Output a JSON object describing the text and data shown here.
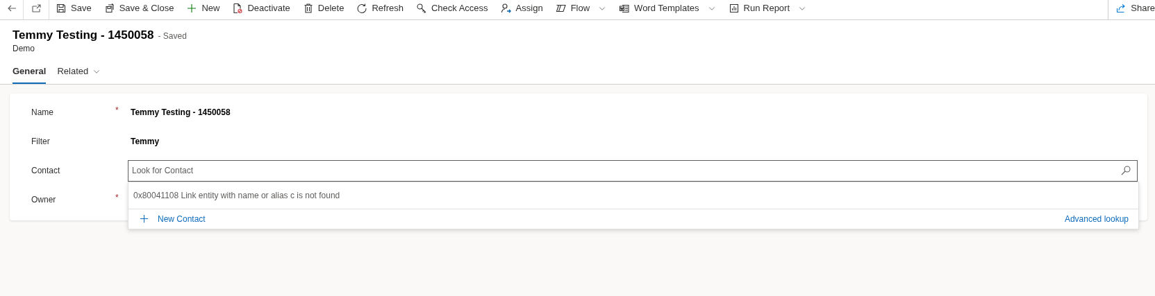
{
  "toolbar": {
    "commands": [
      {
        "label": "Save",
        "kind": "save",
        "dropdown": false
      },
      {
        "label": "Save & Close",
        "kind": "save-close",
        "dropdown": false
      },
      {
        "label": "New",
        "kind": "new",
        "dropdown": false
      },
      {
        "label": "Deactivate",
        "kind": "deactivate",
        "dropdown": false
      },
      {
        "label": "Delete",
        "kind": "delete",
        "dropdown": false
      },
      {
        "label": "Refresh",
        "kind": "refresh",
        "dropdown": false
      },
      {
        "label": "Check Access",
        "kind": "key",
        "dropdown": false
      },
      {
        "label": "Assign",
        "kind": "assign",
        "dropdown": false
      },
      {
        "label": "Flow",
        "kind": "flow",
        "dropdown": true
      },
      {
        "label": "Word Templates",
        "kind": "word",
        "dropdown": true
      },
      {
        "label": "Run Report",
        "kind": "report",
        "dropdown": true
      }
    ],
    "share": {
      "label": "Share"
    }
  },
  "header": {
    "title": "Temmy Testing - 1450058",
    "status": "- Saved",
    "subtitle": "Demo"
  },
  "tabs": [
    {
      "label": "General",
      "selected": true,
      "dropdown": false
    },
    {
      "label": "Related",
      "selected": false,
      "dropdown": true
    }
  ],
  "fields": [
    {
      "label": "Name",
      "required_mark": "*",
      "kind": "text",
      "value": "Temmy Testing - 1450058"
    },
    {
      "label": "Filter",
      "kind": "text",
      "value": "Temmy"
    },
    {
      "label": "Contact",
      "kind": "lookup",
      "placeholder": "Look for Contact"
    },
    {
      "label": "Owner",
      "required_mark": "*",
      "kind": "text"
    }
  ],
  "lookup_dropdown": {
    "message": "0x80041108 Link entity with name or alias c is not found",
    "new_label": "New Contact",
    "advanced_label": "Advanced lookup"
  }
}
